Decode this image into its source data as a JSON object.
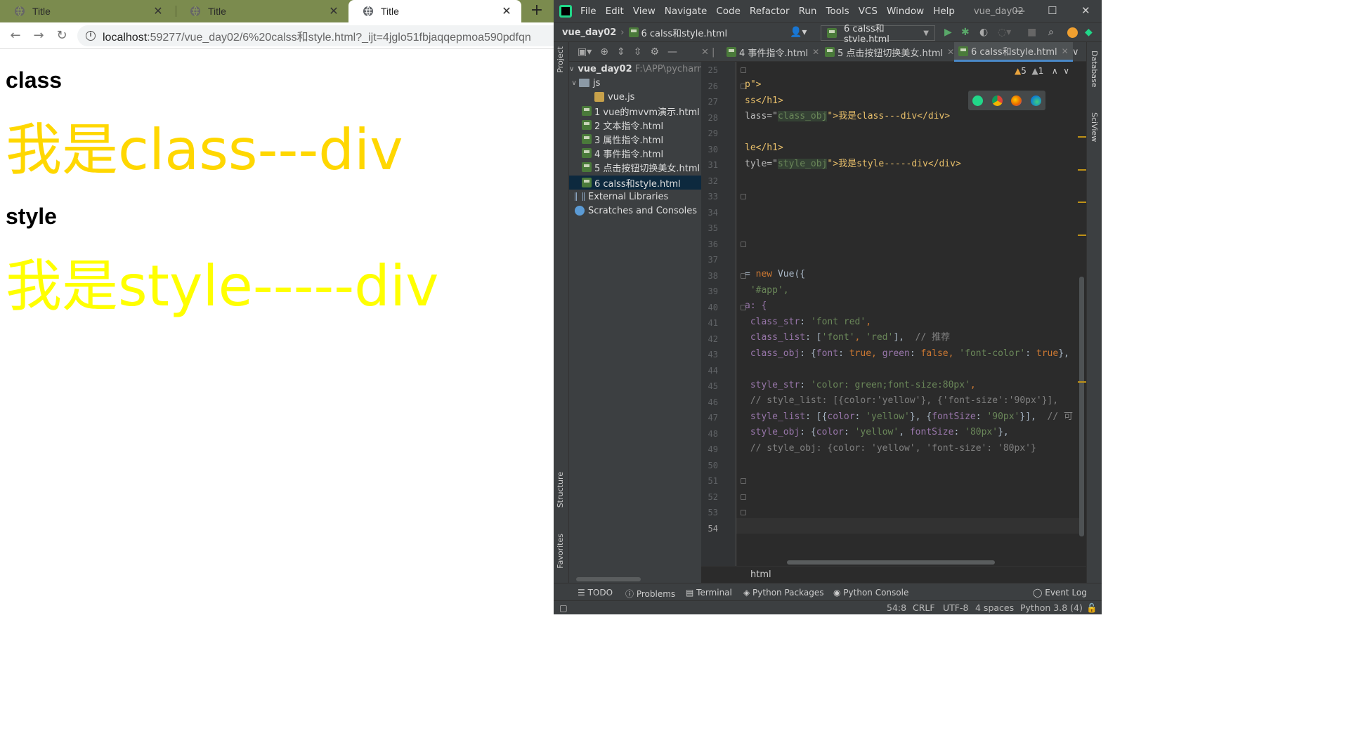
{
  "browser": {
    "tabs": [
      {
        "label": "Title"
      },
      {
        "label": "Title"
      },
      {
        "label": "Title"
      }
    ],
    "url": {
      "host": "localhost",
      "rest": ":59277/vue_day02/6%20calss和style.html?_ijt=4jglo51fbjaqqepmoa590pdfqn"
    },
    "page": {
      "h1_class": "class",
      "div_class": "我是class---div",
      "h1_style": "style",
      "div_style": "我是style-----div",
      "class_color": "#ffd700",
      "style_color": "#ffff00"
    }
  },
  "ide": {
    "menu": [
      "File",
      "Edit",
      "View",
      "Navigate",
      "Code",
      "Refactor",
      "Run",
      "Tools",
      "VCS",
      "Window",
      "Help"
    ],
    "window_title": "vue_day02",
    "navbar": {
      "project": "vue_day02",
      "file": "6 calss和style.html",
      "run_config": "6 calss和style.html"
    },
    "project": {
      "root": "vue_day02",
      "root_path": "F:\\APP\\pycharm",
      "folder_js": "js",
      "files": [
        "vue.js",
        "1 vue的mvvm演示.html",
        "2 文本指令.html",
        "3 属性指令.html",
        "4 事件指令.html",
        "5 点击按钮切换美女.html",
        "6 calss和style.html"
      ],
      "external": "External Libraries",
      "scratches": "Scratches and Consoles"
    },
    "editor_tabs": [
      "4 事件指令.html",
      "5 点击按钮切换美女.html",
      "6 calss和style.html"
    ],
    "warnings": {
      "warn": "5",
      "weak": "1"
    },
    "line_numbers": [
      "25",
      "26",
      "27",
      "28",
      "29",
      "30",
      "31",
      "32",
      "33",
      "34",
      "35",
      "36",
      "37",
      "38",
      "39",
      "40",
      "41",
      "42",
      "43",
      "44",
      "45",
      "46",
      "47",
      "48",
      "49",
      "50",
      "51",
      "52",
      "53",
      "54"
    ],
    "code": {
      "l26": "p\">",
      "l27": "ss</h1>",
      "l28a": "lass=\"",
      "l28b": "class_obj",
      "l28c": "\">我是class---div</div>",
      "l30": "le</h1>",
      "l31a": "tyle=\"",
      "l31b": "style_obj",
      "l31c": "\">我是style-----div</div>",
      "l38a": "= ",
      "l38b": "new",
      "l38c": " Vue({",
      "l39": " '#app',",
      "l40": "a: {",
      "l41a": " class_str",
      "l41b": ": ",
      "l41c": "'font red'",
      "l41d": ",",
      "l42a": " class_list",
      "l42b": ": [",
      "l42c": "'font'",
      "l42d": ", ",
      "l42e": "'red'",
      "l42f": "],  ",
      "l42g": "// 推荐",
      "l43a": " class_obj",
      "l43b": ": {",
      "l43c": "font",
      "l43d": ": ",
      "l43e": "true",
      "l43f": ", ",
      "l43g": "green",
      "l43h": ": ",
      "l43i": "false",
      "l43j": ", ",
      "l43k": "'font-color'",
      "l43l": ": ",
      "l43m": "true",
      "l43n": "},",
      "l45a": " style_str",
      "l45b": ": ",
      "l45c": "'color: green;font-size:80px'",
      "l45d": ",",
      "l46": " // style_list: [{color:'yellow'}, {'font-size':'90px'}],",
      "l47a": " style_list",
      "l47b": ": [{",
      "l47c": "color",
      "l47d": ": ",
      "l47e": "'yellow'",
      "l47f": "}, {",
      "l47g": "fontSize",
      "l47h": ": ",
      "l47i": "'90px'",
      "l47j": "}],  ",
      "l47k": "// 可",
      "l48a": " style_obj",
      "l48b": ": {",
      "l48c": "color",
      "l48d": ": ",
      "l48e": "'yellow'",
      "l48f": ", ",
      "l48g": "fontSize",
      "l48h": ": ",
      "l48i": "'80px'",
      "l48j": "},",
      "l49": " // style_obj: {color: 'yellow', 'font-size': '80px'}"
    },
    "breadcrumb": "html",
    "side": {
      "project": "Project",
      "structure": "Structure",
      "favorites": "Favorites",
      "database": "Database",
      "sciview": "SciView"
    },
    "bottom_tools": [
      "TODO",
      "Problems",
      "Terminal",
      "Python Packages",
      "Python Console",
      "Event Log"
    ],
    "status": {
      "pos": "54:8",
      "eol": "CRLF",
      "enc": "UTF-8",
      "indent": "4 spaces",
      "interp": "Python 3.8 (4)"
    }
  }
}
